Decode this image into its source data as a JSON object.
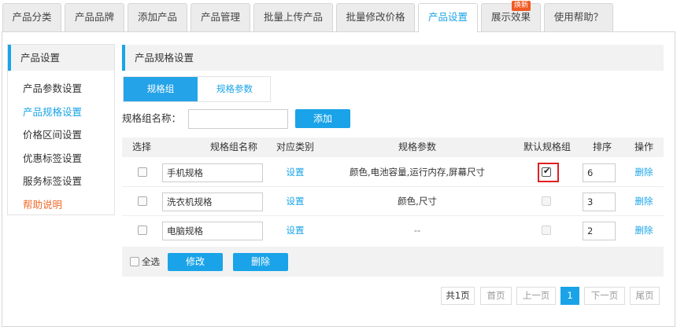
{
  "tabs": [
    {
      "label": "产品分类"
    },
    {
      "label": "产品品牌"
    },
    {
      "label": "添加产品"
    },
    {
      "label": "产品管理"
    },
    {
      "label": "批量上传产品"
    },
    {
      "label": "批量修改价格"
    },
    {
      "label": "产品设置"
    },
    {
      "label": "展示效果",
      "badge": "焕新"
    },
    {
      "label": "使用帮助？"
    }
  ],
  "sidebar": {
    "title": "产品设置",
    "items": [
      {
        "label": "产品参数设置"
      },
      {
        "label": "产品规格设置"
      },
      {
        "label": "价格区间设置"
      },
      {
        "label": "优惠标签设置"
      },
      {
        "label": "服务标签设置"
      },
      {
        "label": "帮助说明"
      }
    ]
  },
  "main": {
    "title": "产品规格设置",
    "subtabs": [
      "规格组",
      "规格参数"
    ],
    "name_label": "规格组名称：",
    "name_value": "",
    "add_button": "添加"
  },
  "table": {
    "headers": [
      "选择",
      "规格组名称",
      "对应类别",
      "规格参数",
      "默认规格组",
      "排序",
      "操作"
    ],
    "rows": [
      {
        "name": "手机规格",
        "category": "设置",
        "params": "颜色,电池容量,运行内存,屏幕尺寸",
        "default": true,
        "sort": "6",
        "action": "删除"
      },
      {
        "name": "洗衣机规格",
        "category": "设置",
        "params": "颜色,尺寸",
        "default": false,
        "sort": "3",
        "action": "删除"
      },
      {
        "name": "电脑规格",
        "category": "设置",
        "params": "--",
        "default": false,
        "sort": "2",
        "action": "删除"
      }
    ]
  },
  "footer": {
    "select_all": "全选",
    "edit_button": "修改",
    "delete_button": "删除"
  },
  "pagination": {
    "total": "共1页",
    "first": "首页",
    "prev": "上一页",
    "current": "1",
    "next": "下一页",
    "last": "尾页"
  },
  "colors": {
    "accent": "#1aa3e8",
    "help": "#f06a2a",
    "highlight": "#e02020"
  }
}
